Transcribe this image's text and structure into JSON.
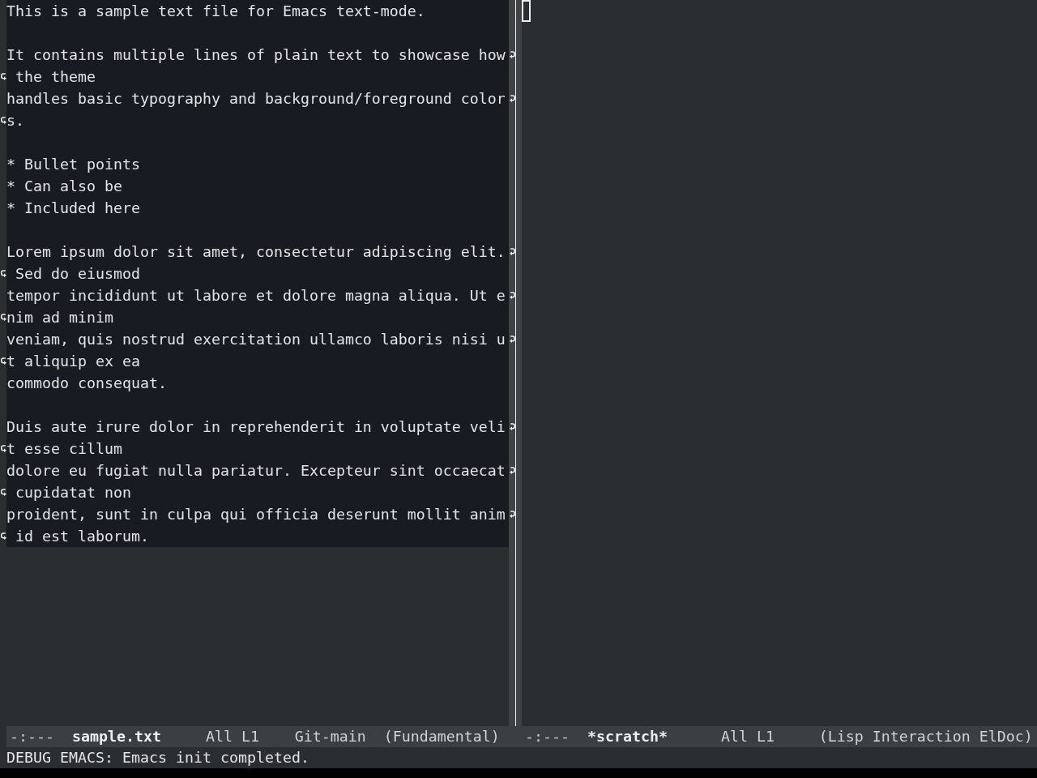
{
  "left_window": {
    "lines": [
      {
        "kind": "text",
        "rows": [
          "This is a sample text file for Emacs text-mode."
        ]
      },
      {
        "kind": "blank"
      },
      {
        "kind": "text",
        "rows": [
          "It contains multiple lines of plain text to showcase how",
          " the theme"
        ]
      },
      {
        "kind": "text",
        "rows": [
          "handles basic typography and background/foreground color",
          "s."
        ]
      },
      {
        "kind": "blank"
      },
      {
        "kind": "text",
        "rows": [
          "* Bullet points"
        ]
      },
      {
        "kind": "text",
        "rows": [
          "* Can also be"
        ]
      },
      {
        "kind": "text",
        "rows": [
          "* Included here"
        ]
      },
      {
        "kind": "blank"
      },
      {
        "kind": "text",
        "rows": [
          "Lorem ipsum dolor sit amet, consectetur adipiscing elit.",
          " Sed do eiusmod"
        ]
      },
      {
        "kind": "text",
        "rows": [
          "tempor incididunt ut labore et dolore magna aliqua. Ut e",
          "nim ad minim"
        ]
      },
      {
        "kind": "text",
        "rows": [
          "veniam, quis nostrud exercitation ullamco laboris nisi u",
          "t aliquip ex ea"
        ]
      },
      {
        "kind": "text",
        "rows": [
          "commodo consequat."
        ]
      },
      {
        "kind": "blank"
      },
      {
        "kind": "text",
        "rows": [
          "Duis aute irure dolor in reprehenderit in voluptate veli",
          "t esse cillum"
        ]
      },
      {
        "kind": "text",
        "rows": [
          "dolore eu fugiat nulla pariatur. Excepteur sint occaecat",
          " cupidatat non"
        ]
      },
      {
        "kind": "text",
        "rows": [
          "proident, sunt in culpa qui officia deserunt mollit anim",
          " id est laborum."
        ]
      }
    ],
    "mode_line": {
      "status": "-:---",
      "buffer_name": "sample.txt",
      "position": "All L1",
      "vc": "Git-main",
      "modes": "(Fundamental)"
    }
  },
  "right_window": {
    "cursor_hollow": true,
    "mode_line": {
      "status": "-:---",
      "buffer_name": "*scratch*",
      "position": "All L1",
      "modes": "(Lisp Interaction ElDoc)"
    }
  },
  "echo_area": "DEBUG EMACS: Emacs init completed."
}
